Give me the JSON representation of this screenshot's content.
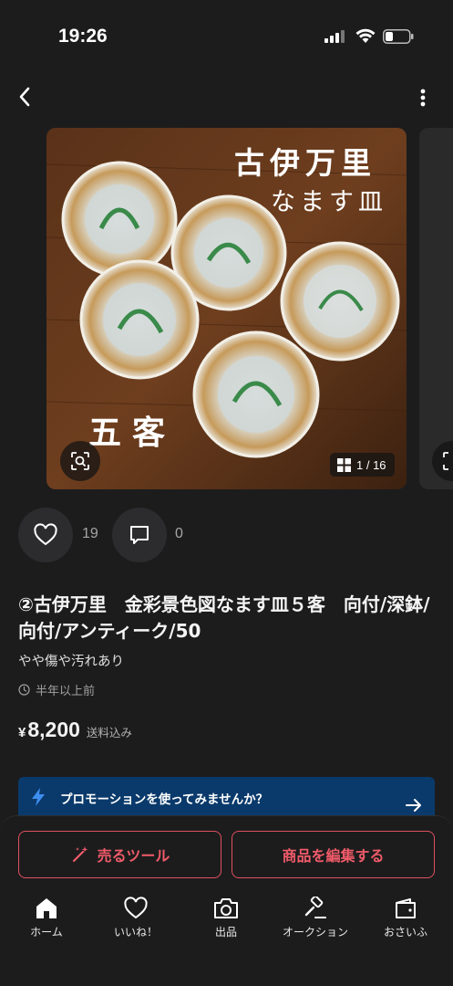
{
  "status_bar": {
    "time": "19:26"
  },
  "gallery": {
    "image_calligraphy_title": "古伊万里",
    "image_calligraphy_subtitle": "なます皿",
    "image_calligraphy_count": "五客",
    "counter": "1 / 16"
  },
  "reactions": {
    "likes": "19",
    "comments": "0"
  },
  "item": {
    "title": "②古伊万里　金彩景色図なます皿５客　向付/深鉢/向付/アンティーク/50",
    "condition": "やや傷や汚れあり",
    "posted": "半年以上前",
    "currency": "¥",
    "price": "8,200",
    "shipping": "送料込み"
  },
  "promo": {
    "text": "プロモーションを使ってみませんか？"
  },
  "actions": {
    "tools": "売るツール",
    "edit": "商品を編集する"
  },
  "tabs": [
    {
      "label": "ホーム",
      "icon": "home-icon"
    },
    {
      "label": "いいね！",
      "icon": "heart-icon"
    },
    {
      "label": "出品",
      "icon": "camera-icon"
    },
    {
      "label": "オークション",
      "icon": "gavel-icon"
    },
    {
      "label": "おさいふ",
      "icon": "wallet-icon"
    }
  ],
  "colors": {
    "background": "#1c1c1d",
    "accent": "#ef5b69",
    "promo_bg": "#0a3a6b",
    "promo_icon": "#3d8ef0"
  }
}
